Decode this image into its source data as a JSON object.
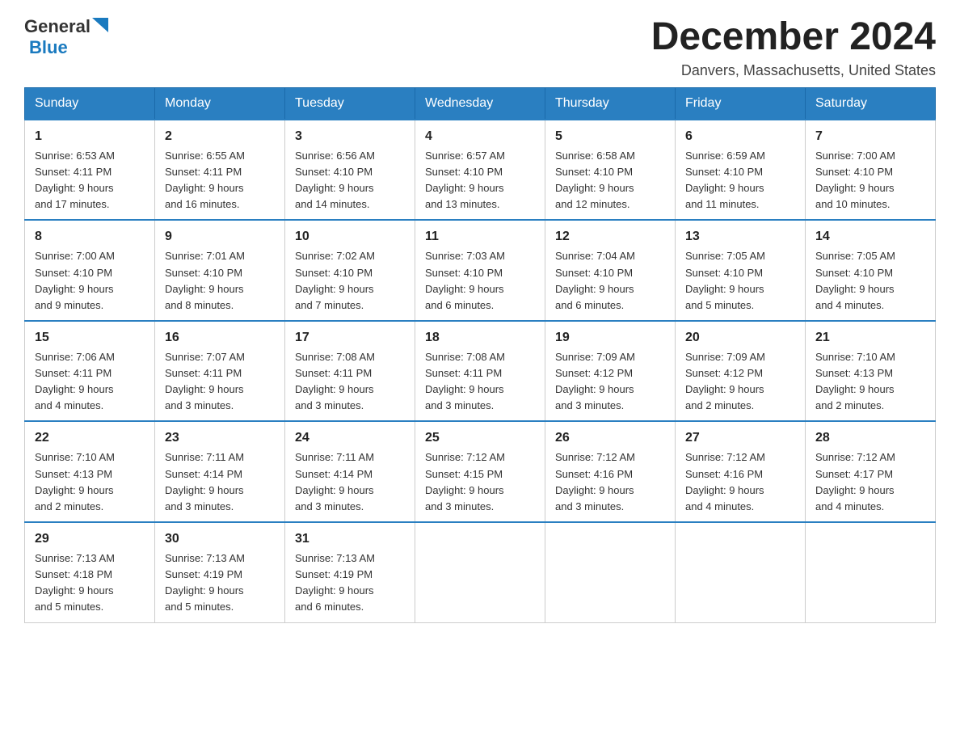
{
  "header": {
    "logo": {
      "general": "General",
      "blue": "Blue"
    },
    "title": "December 2024",
    "location": "Danvers, Massachusetts, United States"
  },
  "calendar": {
    "weekdays": [
      "Sunday",
      "Monday",
      "Tuesday",
      "Wednesday",
      "Thursday",
      "Friday",
      "Saturday"
    ],
    "weeks": [
      [
        {
          "day": "1",
          "sunrise": "6:53 AM",
          "sunset": "4:11 PM",
          "daylight": "9 hours and 17 minutes."
        },
        {
          "day": "2",
          "sunrise": "6:55 AM",
          "sunset": "4:11 PM",
          "daylight": "9 hours and 16 minutes."
        },
        {
          "day": "3",
          "sunrise": "6:56 AM",
          "sunset": "4:10 PM",
          "daylight": "9 hours and 14 minutes."
        },
        {
          "day": "4",
          "sunrise": "6:57 AM",
          "sunset": "4:10 PM",
          "daylight": "9 hours and 13 minutes."
        },
        {
          "day": "5",
          "sunrise": "6:58 AM",
          "sunset": "4:10 PM",
          "daylight": "9 hours and 12 minutes."
        },
        {
          "day": "6",
          "sunrise": "6:59 AM",
          "sunset": "4:10 PM",
          "daylight": "9 hours and 11 minutes."
        },
        {
          "day": "7",
          "sunrise": "7:00 AM",
          "sunset": "4:10 PM",
          "daylight": "9 hours and 10 minutes."
        }
      ],
      [
        {
          "day": "8",
          "sunrise": "7:00 AM",
          "sunset": "4:10 PM",
          "daylight": "9 hours and 9 minutes."
        },
        {
          "day": "9",
          "sunrise": "7:01 AM",
          "sunset": "4:10 PM",
          "daylight": "9 hours and 8 minutes."
        },
        {
          "day": "10",
          "sunrise": "7:02 AM",
          "sunset": "4:10 PM",
          "daylight": "9 hours and 7 minutes."
        },
        {
          "day": "11",
          "sunrise": "7:03 AM",
          "sunset": "4:10 PM",
          "daylight": "9 hours and 6 minutes."
        },
        {
          "day": "12",
          "sunrise": "7:04 AM",
          "sunset": "4:10 PM",
          "daylight": "9 hours and 6 minutes."
        },
        {
          "day": "13",
          "sunrise": "7:05 AM",
          "sunset": "4:10 PM",
          "daylight": "9 hours and 5 minutes."
        },
        {
          "day": "14",
          "sunrise": "7:05 AM",
          "sunset": "4:10 PM",
          "daylight": "9 hours and 4 minutes."
        }
      ],
      [
        {
          "day": "15",
          "sunrise": "7:06 AM",
          "sunset": "4:11 PM",
          "daylight": "9 hours and 4 minutes."
        },
        {
          "day": "16",
          "sunrise": "7:07 AM",
          "sunset": "4:11 PM",
          "daylight": "9 hours and 3 minutes."
        },
        {
          "day": "17",
          "sunrise": "7:08 AM",
          "sunset": "4:11 PM",
          "daylight": "9 hours and 3 minutes."
        },
        {
          "day": "18",
          "sunrise": "7:08 AM",
          "sunset": "4:11 PM",
          "daylight": "9 hours and 3 minutes."
        },
        {
          "day": "19",
          "sunrise": "7:09 AM",
          "sunset": "4:12 PM",
          "daylight": "9 hours and 3 minutes."
        },
        {
          "day": "20",
          "sunrise": "7:09 AM",
          "sunset": "4:12 PM",
          "daylight": "9 hours and 2 minutes."
        },
        {
          "day": "21",
          "sunrise": "7:10 AM",
          "sunset": "4:13 PM",
          "daylight": "9 hours and 2 minutes."
        }
      ],
      [
        {
          "day": "22",
          "sunrise": "7:10 AM",
          "sunset": "4:13 PM",
          "daylight": "9 hours and 2 minutes."
        },
        {
          "day": "23",
          "sunrise": "7:11 AM",
          "sunset": "4:14 PM",
          "daylight": "9 hours and 3 minutes."
        },
        {
          "day": "24",
          "sunrise": "7:11 AM",
          "sunset": "4:14 PM",
          "daylight": "9 hours and 3 minutes."
        },
        {
          "day": "25",
          "sunrise": "7:12 AM",
          "sunset": "4:15 PM",
          "daylight": "9 hours and 3 minutes."
        },
        {
          "day": "26",
          "sunrise": "7:12 AM",
          "sunset": "4:16 PM",
          "daylight": "9 hours and 3 minutes."
        },
        {
          "day": "27",
          "sunrise": "7:12 AM",
          "sunset": "4:16 PM",
          "daylight": "9 hours and 4 minutes."
        },
        {
          "day": "28",
          "sunrise": "7:12 AM",
          "sunset": "4:17 PM",
          "daylight": "9 hours and 4 minutes."
        }
      ],
      [
        {
          "day": "29",
          "sunrise": "7:13 AM",
          "sunset": "4:18 PM",
          "daylight": "9 hours and 5 minutes."
        },
        {
          "day": "30",
          "sunrise": "7:13 AM",
          "sunset": "4:19 PM",
          "daylight": "9 hours and 5 minutes."
        },
        {
          "day": "31",
          "sunrise": "7:13 AM",
          "sunset": "4:19 PM",
          "daylight": "9 hours and 6 minutes."
        },
        null,
        null,
        null,
        null
      ]
    ],
    "labels": {
      "sunrise": "Sunrise:",
      "sunset": "Sunset:",
      "daylight": "Daylight:"
    }
  }
}
